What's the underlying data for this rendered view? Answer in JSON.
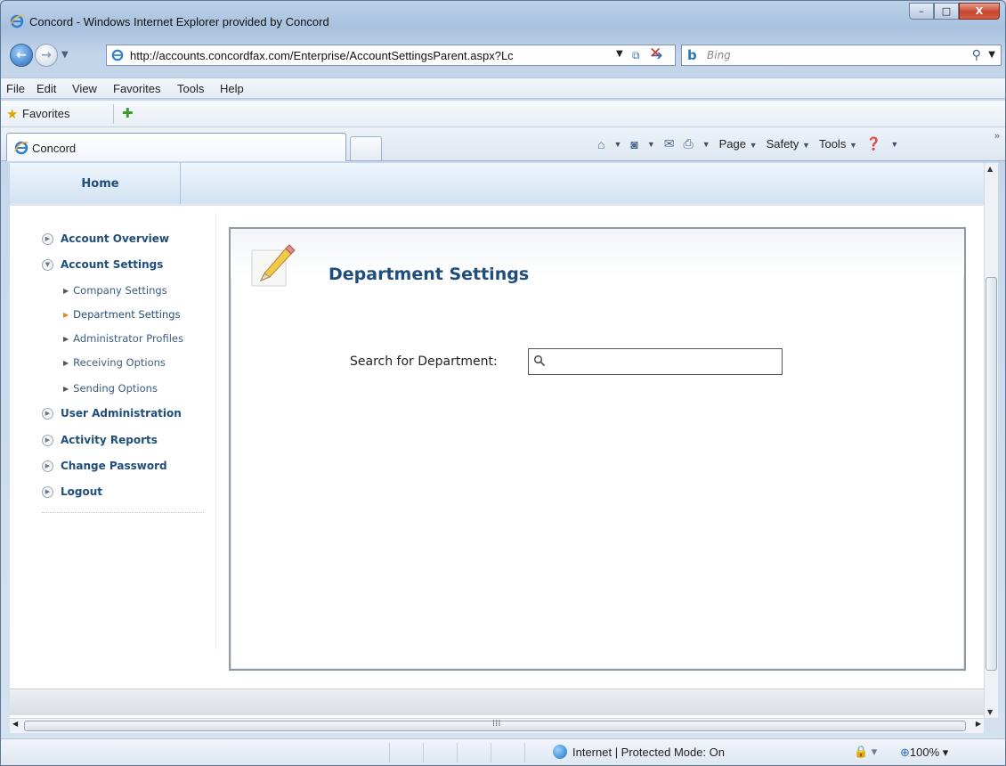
{
  "window": {
    "title": "Concord - Windows Internet Explorer provided by Concord",
    "minimize_label": "–",
    "maximize_label": "□",
    "close_label": "X"
  },
  "address_bar": {
    "url": "http://accounts.concordfax.com/Enterprise/AccountSettingsParent.aspx?Lc",
    "search_engine": "Bing",
    "search_placeholder": "Bing"
  },
  "menu": {
    "items": [
      "File",
      "Edit",
      "View",
      "Favorites",
      "Tools",
      "Help"
    ]
  },
  "favorites_bar": {
    "label": "Favorites"
  },
  "tabs": {
    "active_label": "Concord"
  },
  "command_bar": {
    "page_label": "Page",
    "safety_label": "Safety",
    "tools_label": "Tools"
  },
  "site_nav": {
    "home_label": "Home"
  },
  "sidebar": {
    "items": [
      {
        "label": "Account Overview",
        "expanded": false
      },
      {
        "label": "Account Settings",
        "expanded": true
      },
      {
        "label": "User Administration",
        "expanded": false
      },
      {
        "label": "Activity Reports",
        "expanded": false
      },
      {
        "label": "Change Password",
        "expanded": false
      },
      {
        "label": "Logout",
        "expanded": false
      }
    ],
    "subitems": [
      {
        "label": "Company Settings",
        "active": false
      },
      {
        "label": "Department Settings",
        "active": true
      },
      {
        "label": "Administrator Profiles",
        "active": false
      },
      {
        "label": "Receiving Options",
        "active": false
      },
      {
        "label": "Sending Options",
        "active": false
      }
    ]
  },
  "main": {
    "title": "Department Settings",
    "search_label": "Search for Department:",
    "search_value": "",
    "icon": "pencil-icon"
  },
  "status_bar": {
    "zone": "Internet | Protected Mode: On",
    "zoom": "100%"
  },
  "colors": {
    "accent": "#1f4e7a",
    "active_arrow": "#e28a1a",
    "nav_band": "#d3e3f3"
  }
}
